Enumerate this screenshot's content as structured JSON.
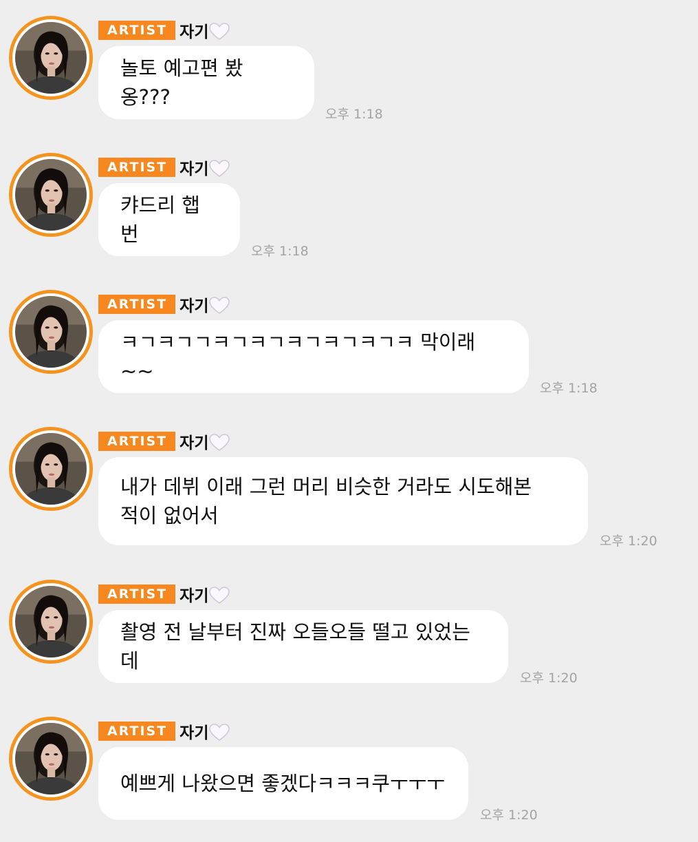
{
  "messages": [
    {
      "badge": "ARTIST",
      "sender": "자기",
      "text": "놀토 예고편 봤옹???",
      "time": "오후 1:18"
    },
    {
      "badge": "ARTIST",
      "sender": "자기",
      "text": "캬드리 햅번",
      "time": "오후 1:18"
    },
    {
      "badge": "ARTIST",
      "sender": "자기",
      "text": "ㅋㄱㅋㄱㄱㅋㄱㅋㄱㅋㄱㅋㄱㅋㄱㅋ 막이래~~",
      "time": "오후 1:18"
    },
    {
      "badge": "ARTIST",
      "sender": "자기",
      "text": "내가 데뷔 이래 그런 머리 비슷한 거라도 시도해본\n적이 없어서",
      "time": "오후 1:20"
    },
    {
      "badge": "ARTIST",
      "sender": "자기",
      "text": "촬영 전 날부터 진짜 오들오들 떨고 있었는데",
      "time": "오후 1:20"
    },
    {
      "badge": "ARTIST",
      "sender": "자기",
      "text": "예쁘게 나왔으면 좋겠다ㅋㅋㅋ쿠ㅜㅜㅜ",
      "time": "오후 1:20"
    }
  ],
  "colors": {
    "background": "#eeeeee",
    "badge": "#f7881f",
    "avatar_ring": "#f5931f",
    "bubble": "#ffffff",
    "time": "#a3a3a3"
  },
  "icons": {
    "heart": "white-heart-icon",
    "avatar": "artist-avatar"
  }
}
